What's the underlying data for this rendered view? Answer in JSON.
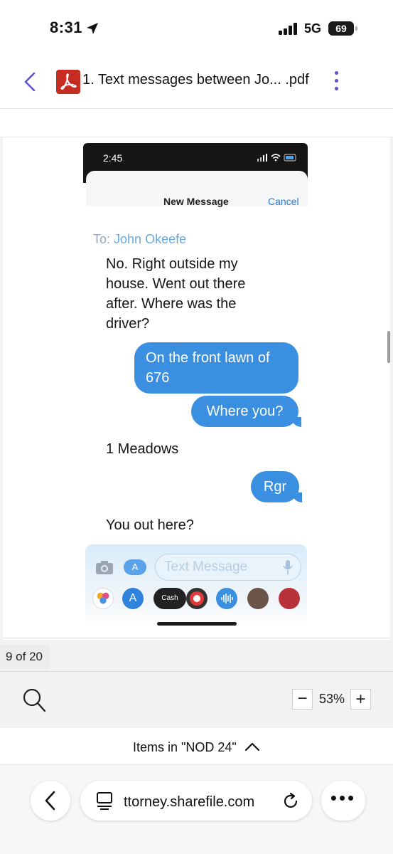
{
  "status_bar": {
    "time": "8:31",
    "network": "5G",
    "battery": "69"
  },
  "header": {
    "title": "1. Text messages between Jo... .pdf"
  },
  "document": {
    "phone_time": "2:45",
    "compose_title": "New Message",
    "cancel_label": "Cancel",
    "to_label": "To:",
    "to_name": "John Okeefe",
    "messages": [
      {
        "from": "received",
        "text": "No. Right outside my house. Went out there after. Where was the driver?"
      },
      {
        "from": "sent",
        "text": "On the front lawn of 676"
      },
      {
        "from": "sent",
        "text": "Where you?"
      },
      {
        "from": "received",
        "text": "1 Meadows"
      },
      {
        "from": "sent",
        "text": "Rgr"
      },
      {
        "from": "received",
        "text": "You out here?"
      }
    ],
    "input_placeholder": "Text Message",
    "cash_label": "Cash",
    "page_indicator": "9 of 20"
  },
  "toolbar": {
    "zoom_minus": "−",
    "zoom_level": "53%",
    "zoom_plus": "+"
  },
  "folder": {
    "label": "Items in \"NOD 24\""
  },
  "browser": {
    "url": "ttorney.sharefile.com",
    "more_label": "•••"
  },
  "colors": {
    "accent": "#5b4fd0",
    "pdf_red": "#c62c21",
    "bubble_blue": "#3a8fe0"
  }
}
